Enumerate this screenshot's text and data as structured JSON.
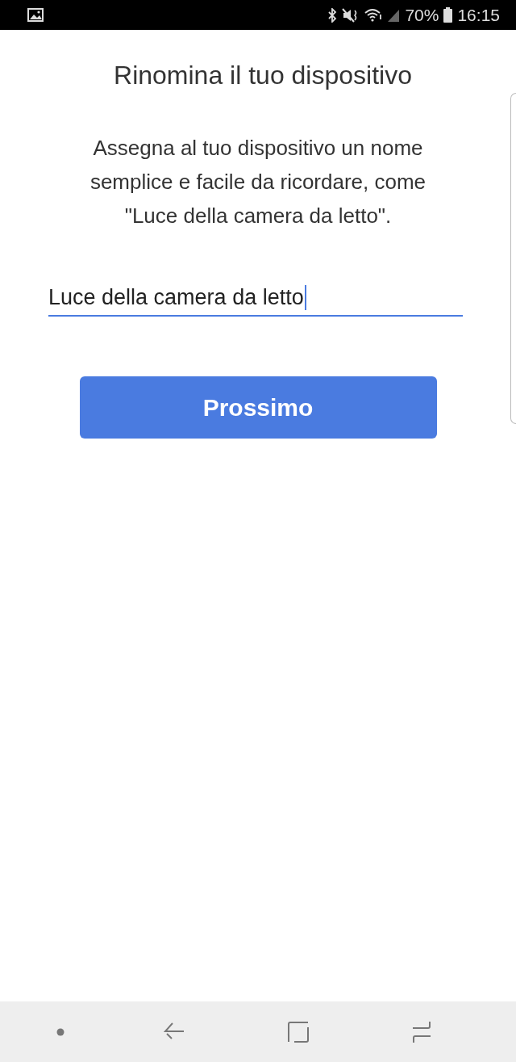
{
  "status_bar": {
    "battery": "70%",
    "time": "16:15"
  },
  "title": "Rinomina il tuo dispositivo",
  "description": "Assegna al tuo dispositivo un nome semplice e facile da ricordare, come \"Luce della camera da letto\".",
  "name_field": {
    "value": "Luce della camera da letto",
    "focused": true
  },
  "next_button": {
    "label": "Prossimo"
  }
}
